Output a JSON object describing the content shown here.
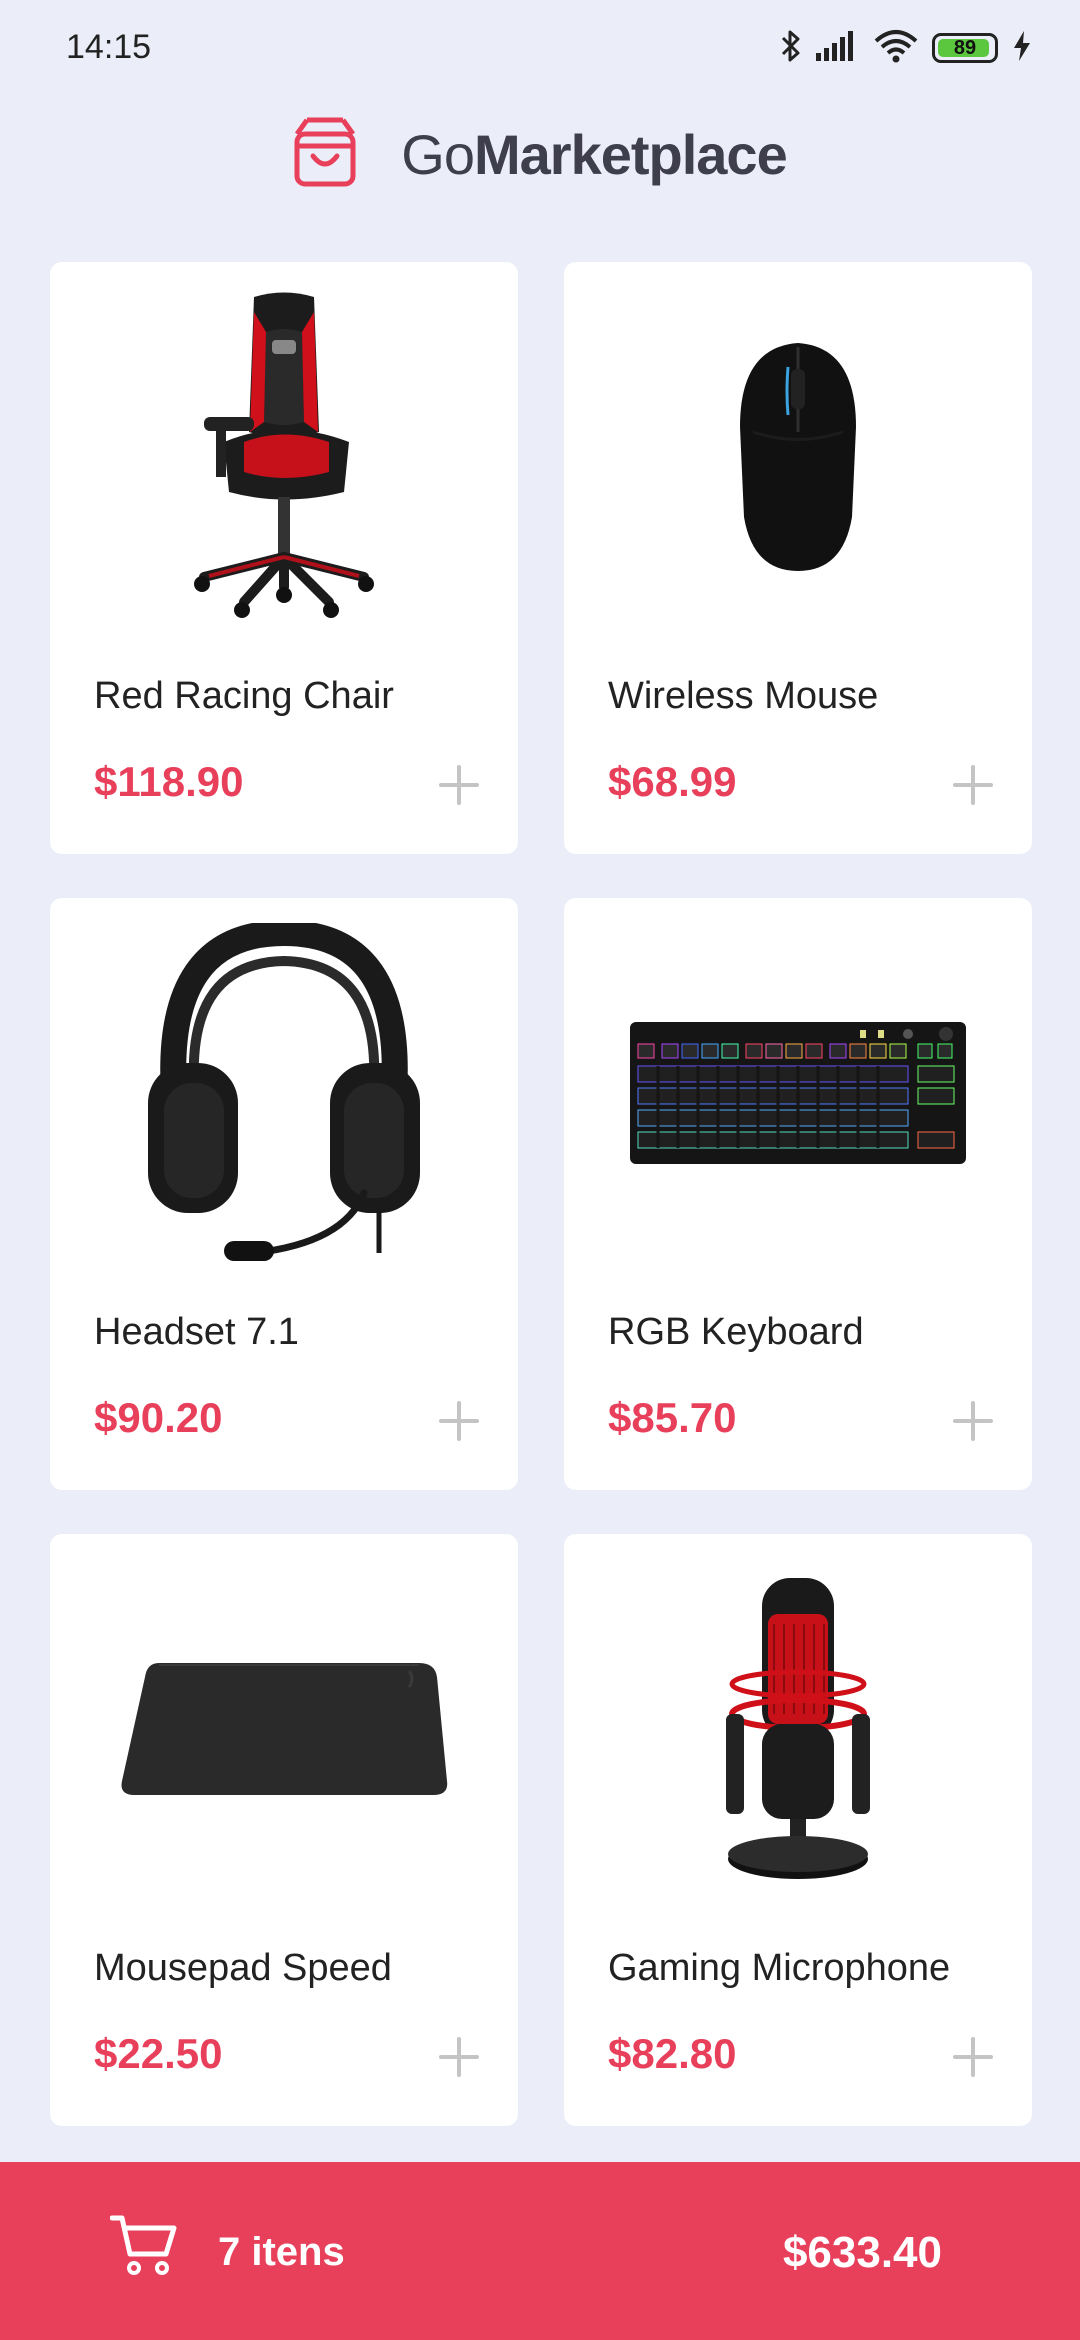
{
  "status_bar": {
    "time": "14:15",
    "battery_level": "89",
    "icons": [
      "bluetooth-icon",
      "signal-icon",
      "wifi-icon",
      "battery-icon",
      "charging-icon"
    ]
  },
  "header": {
    "brand_light": "Go",
    "brand_bold": "Marketplace",
    "logo_icon": "shopping-bag-icon"
  },
  "products": [
    {
      "title": "Red Racing Chair",
      "price": "$118.90",
      "image": "racing-chair"
    },
    {
      "title": "Wireless Mouse",
      "price": "$68.99",
      "image": "wireless-mouse"
    },
    {
      "title": "Headset 7.1",
      "price": "$90.20",
      "image": "headset"
    },
    {
      "title": "RGB Keyboard",
      "price": "$85.70",
      "image": "rgb-keyboard"
    },
    {
      "title": "Mousepad Speed",
      "price": "$22.50",
      "image": "mousepad"
    },
    {
      "title": "Gaming Microphone",
      "price": "$82.80",
      "image": "gaming-microphone"
    }
  ],
  "cart": {
    "count_label": "7 itens",
    "total": "$633.40",
    "icon": "cart-icon"
  },
  "colors": {
    "background": "#EBEEF8",
    "accent": "#E83F5B",
    "card": "#FFFFFF",
    "brand_text": "#3E3E4D"
  }
}
